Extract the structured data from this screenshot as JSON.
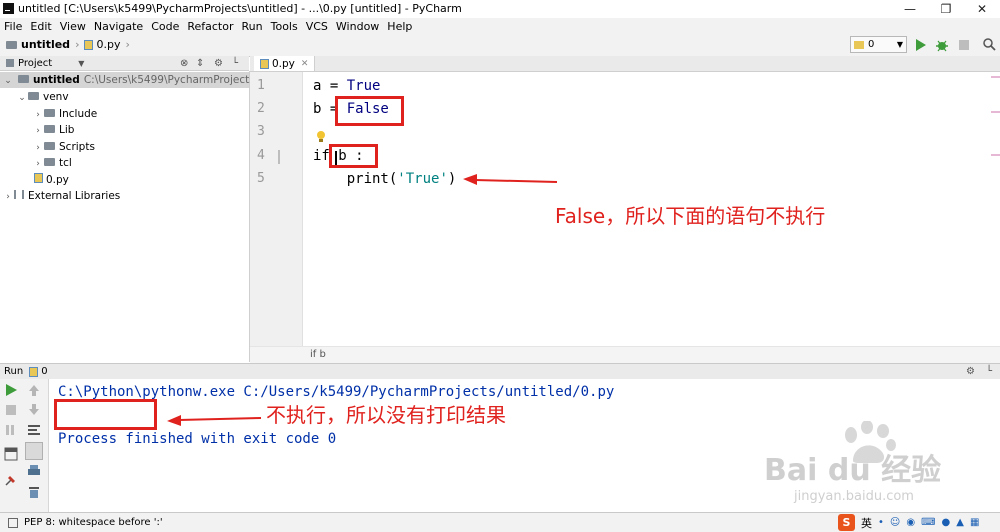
{
  "window": {
    "title": "untitled [C:\\Users\\k5499\\PycharmProjects\\untitled] - ...\\0.py [untitled] - PyCharm"
  },
  "menu": [
    "File",
    "Edit",
    "View",
    "Navigate",
    "Code",
    "Refactor",
    "Run",
    "Tools",
    "VCS",
    "Window",
    "Help"
  ],
  "breadcrumb": {
    "project": "untitled",
    "file": "0.py"
  },
  "run_config": {
    "selected": "0"
  },
  "project_panel": {
    "title": "Project",
    "root_name": "untitled",
    "root_path": "C:\\Users\\k5499\\PycharmProjects\\untitle",
    "items": [
      {
        "label": "venv"
      },
      {
        "label": "Include"
      },
      {
        "label": "Lib"
      },
      {
        "label": "Scripts"
      },
      {
        "label": "tcl"
      },
      {
        "label": "0.py"
      },
      {
        "label": "External Libraries"
      }
    ]
  },
  "editor": {
    "tab": "0.py",
    "line_numbers": [
      "1",
      "2",
      "3",
      "4",
      "5"
    ],
    "lines": [
      {
        "a": "a = ",
        "b": "True"
      },
      {
        "a": "b = ",
        "b": "False"
      },
      {
        "a": "",
        "b": ""
      },
      {
        "a": "if ",
        "b": "b :"
      },
      {
        "a": "    print(",
        "b": "'True'",
        "c": ")"
      }
    ],
    "breadcrumb": "if b"
  },
  "run_panel": {
    "title": "Run",
    "config": "0",
    "console": [
      "C:\\Python\\pythonw.exe C:/Users/k5499/PycharmProjects/untitled/0.py",
      "",
      "Process finished with exit code 0"
    ]
  },
  "status": {
    "message": "PEP 8: whitespace before ':'"
  },
  "annotations": {
    "editor_note": "False，所以下面的语句不执行",
    "console_note": "不执行，所以没有打印结果"
  },
  "watermark": {
    "brand": "Bai du 经验",
    "url": "jingyan.baidu.com"
  },
  "tray": {
    "ime": "英"
  },
  "colors": {
    "annotation": "#e0221e",
    "console_text": "#0030a8",
    "keyword": "#000080",
    "string": "#008080"
  }
}
